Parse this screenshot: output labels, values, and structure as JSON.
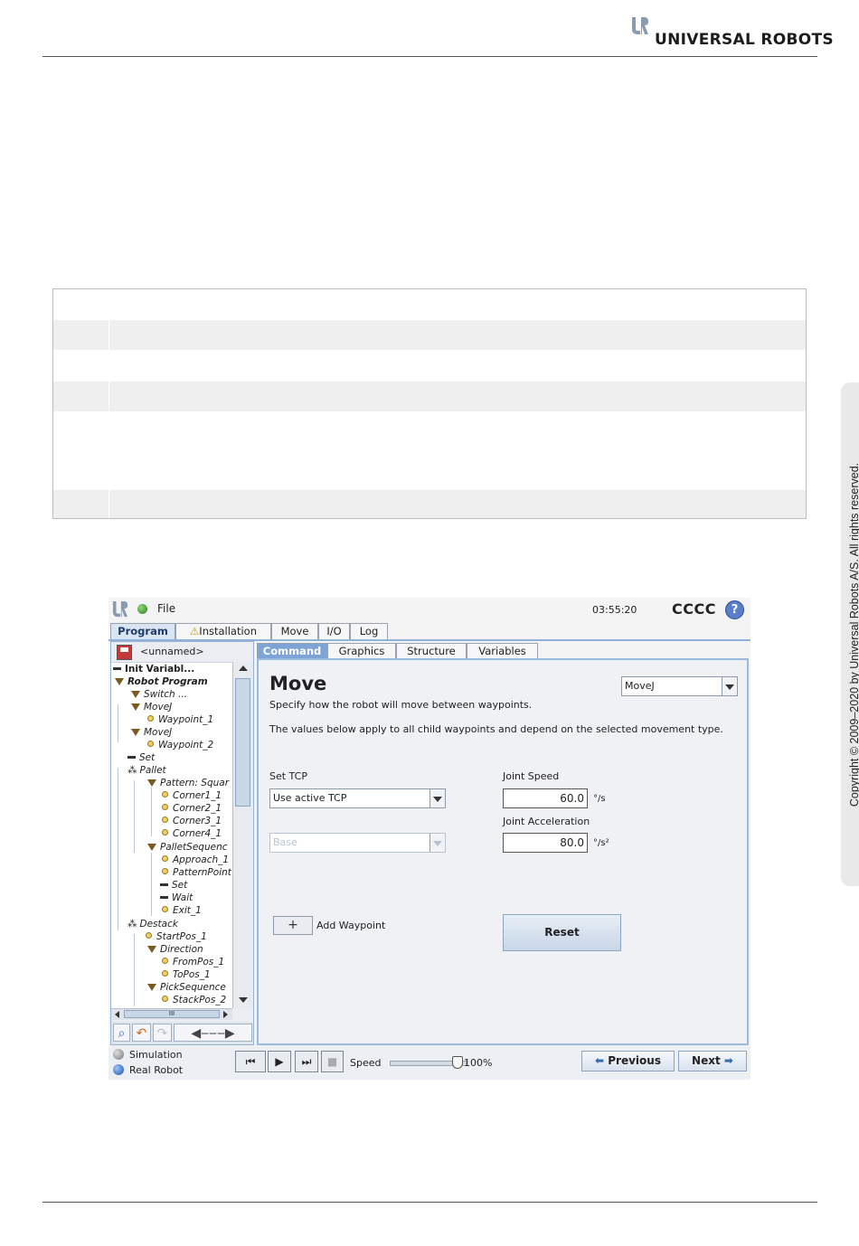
{
  "page": {
    "brand": "UNIVERSAL ROBOTS",
    "copyright": "Copyright © 2009–2020 by Universal Robots A/S. All rights reserved."
  },
  "topbar": {
    "file_label": "File",
    "clock": "03:55:20",
    "robot_name": "CCCC",
    "help_label": "?"
  },
  "main_tabs": [
    {
      "label": "Program",
      "active": true
    },
    {
      "label": "Installation",
      "warning": true
    },
    {
      "label": "Move"
    },
    {
      "label": "I/O"
    },
    {
      "label": "Log"
    }
  ],
  "program": {
    "name": "<unnamed>",
    "tree": [
      {
        "label": "Init Variabl...",
        "kind": "bar"
      },
      {
        "label": "Robot Program",
        "kind": "folder"
      },
      {
        "label": "Switch ...",
        "kind": "folder"
      },
      {
        "label": "MoveJ",
        "kind": "folder"
      },
      {
        "label": "Waypoint_1",
        "kind": "waypoint"
      },
      {
        "label": "MoveJ",
        "kind": "folder",
        "selected": true
      },
      {
        "label": "Waypoint_2",
        "kind": "waypoint"
      },
      {
        "label": "Set",
        "kind": "bar"
      },
      {
        "label": "Pallet",
        "kind": "pallet"
      },
      {
        "label": "Pattern: Squar",
        "kind": "folder"
      },
      {
        "label": "Corner1_1",
        "kind": "waypoint"
      },
      {
        "label": "Corner2_1",
        "kind": "waypoint"
      },
      {
        "label": "Corner3_1",
        "kind": "waypoint"
      },
      {
        "label": "Corner4_1",
        "kind": "waypoint"
      },
      {
        "label": "PalletSequenc",
        "kind": "folder"
      },
      {
        "label": "Approach_1",
        "kind": "waypoint"
      },
      {
        "label": "PatternPoint",
        "kind": "waypoint"
      },
      {
        "label": "Set",
        "kind": "bar"
      },
      {
        "label": "Wait",
        "kind": "bar"
      },
      {
        "label": "Exit_1",
        "kind": "waypoint"
      },
      {
        "label": "Destack",
        "kind": "pallet"
      },
      {
        "label": "StartPos_1",
        "kind": "waypoint"
      },
      {
        "label": "Direction",
        "kind": "folder"
      },
      {
        "label": "FromPos_1",
        "kind": "waypoint"
      },
      {
        "label": "ToPos_1",
        "kind": "waypoint"
      },
      {
        "label": "PickSequence",
        "kind": "folder"
      },
      {
        "label": "StackPos_2",
        "kind": "waypoint"
      }
    ],
    "hscroll_marker": "III"
  },
  "sub_tabs": [
    {
      "label": "Command",
      "active": true
    },
    {
      "label": "Graphics"
    },
    {
      "label": "Structure"
    },
    {
      "label": "Variables"
    }
  ],
  "command": {
    "title": "Move",
    "description": "Specify how the robot will move between waypoints.",
    "description2": "The values below apply to all child waypoints and depend on the selected movement type.",
    "move_type": "MoveJ",
    "set_tcp_label": "Set TCP",
    "tcp_value": "Use active TCP",
    "feature_value": "Base",
    "joint_speed_label": "Joint Speed",
    "joint_speed_value": "60.0",
    "joint_speed_unit": "°/s",
    "joint_accel_label": "Joint Acceleration",
    "joint_accel_value": "80.0",
    "joint_accel_unit": "°/s²",
    "add_waypoint_label": "Add Waypoint",
    "add_waypoint_icon": "+",
    "reset_label": "Reset"
  },
  "bottombar": {
    "simulation_label": "Simulation",
    "real_robot_label": "Real Robot",
    "speed_label": "Speed",
    "speed_value": "100%",
    "speed_fraction": 1.0,
    "previous_label": "Previous",
    "next_label": "Next"
  }
}
